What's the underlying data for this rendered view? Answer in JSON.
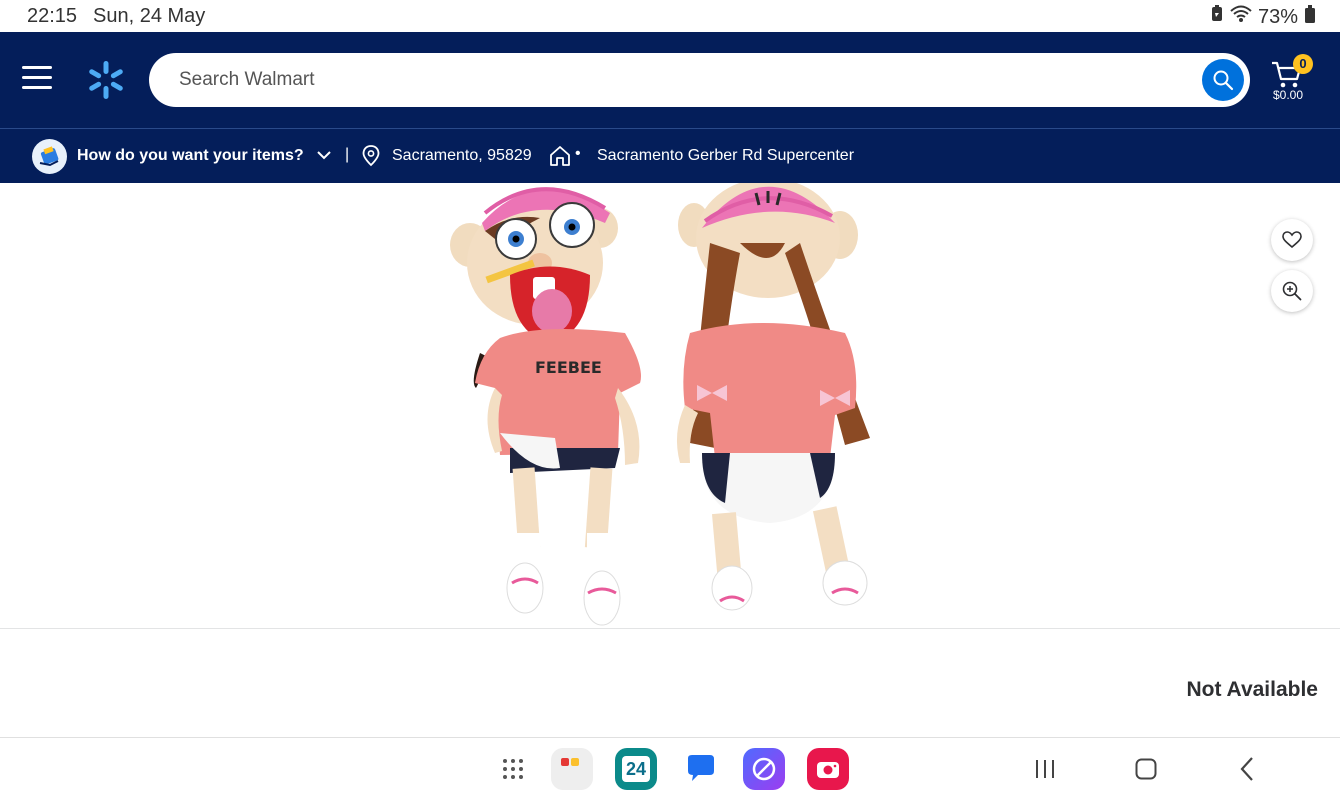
{
  "status_bar": {
    "time": "22:15",
    "date": "Sun, 24 May",
    "battery": "73%"
  },
  "header": {
    "search_placeholder": "Search Walmart",
    "cart_count": "0",
    "cart_total": "$0.00",
    "brand_color": "#041e5a",
    "accent_color": "#0071dc",
    "spark_color": "#ffc220"
  },
  "delivery": {
    "question": "How do you want your items?",
    "separator": "|",
    "location": "Sacramento, 95829",
    "dot": "•",
    "store": "Sacramento Gerber Rd Supercenter"
  },
  "product": {
    "image_description_icon": "puppet-product-image",
    "availability": "Not Available"
  },
  "taskbar": {
    "calendar_day": "24",
    "apps": [
      "app-drawer-icon",
      "folder-app-icon",
      "calendar-app-icon",
      "messages-app-icon",
      "browser-app-icon",
      "camera-app-icon"
    ],
    "nav": [
      "recents-icon",
      "home-icon",
      "back-icon"
    ]
  }
}
